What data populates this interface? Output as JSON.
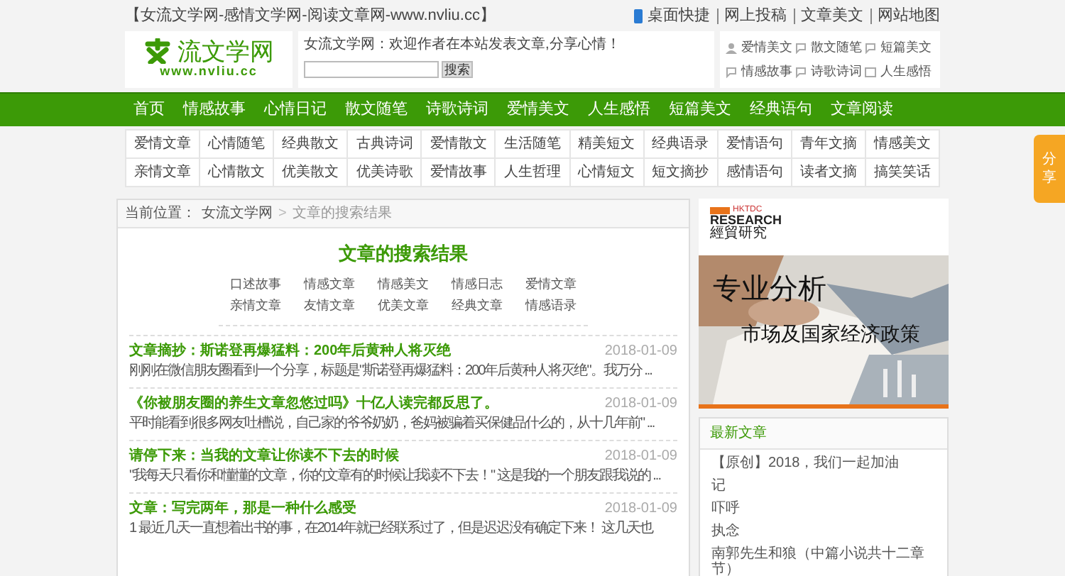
{
  "top_bar": {
    "site_line": "【女流文学网-感情文学网-阅读文章网-www.nvliu.cc】",
    "links": [
      "桌面快捷",
      "网上投稿",
      "文章美文",
      "网站地图"
    ]
  },
  "header": {
    "logo_name": "流文学网",
    "logo_url": "www.nvliu.cc",
    "welcome": "女流文学网：欢迎作者在本站发表文章,分享心情！",
    "search_button": "搜索",
    "quick_links": [
      {
        "label": "爱情美文",
        "kind": "person"
      },
      {
        "label": "散文随笔",
        "kind": "chat"
      },
      {
        "label": "短篇美文",
        "kind": "chat"
      },
      {
        "label": "情感故事",
        "kind": "chat"
      },
      {
        "label": "诗歌诗词",
        "kind": "chat"
      },
      {
        "label": "人生感悟",
        "kind": "doc"
      }
    ]
  },
  "main_nav": [
    "首页",
    "情感故事",
    "心情日记",
    "散文随笔",
    "诗歌诗词",
    "爱情美文",
    "人生感悟",
    "短篇美文",
    "经典语句",
    "文章阅读"
  ],
  "sub_nav": [
    "爱情文章",
    "心情随笔",
    "经典散文",
    "古典诗词",
    "爱情散文",
    "生活随笔",
    "精美短文",
    "经典语录",
    "爱情语句",
    "青年文摘",
    "情感美文",
    "亲情文章",
    "心情散文",
    "优美散文",
    "优美诗歌",
    "爱情故事",
    "人生哲理",
    "心情短文",
    "短文摘抄",
    "感情语句",
    "读者文摘",
    "搞笑笑话"
  ],
  "share_tab": "分享",
  "breadcrumb": {
    "label": "当前位置：",
    "home": "女流文学网",
    "separator": ">",
    "current": "文章的搜索结果"
  },
  "results": {
    "title": "**文章**的搜索结果",
    "categories": [
      "口述故事",
      "情感文章",
      "情感美文",
      "情感日志",
      "爱情文章",
      "亲情文章",
      "友情文章",
      "优美文章",
      "经典文章",
      "情感语录"
    ],
    "articles": [
      {
        "title": "文章摘抄：斯诺登再爆猛料：200年后黄种人将灭绝",
        "date": "2018-01-09",
        "excerpt": "刚刚在微信朋友圈看到一个分享，标题是\"斯诺登再爆猛料：200年后黄种人将灭绝\"。我万分 ..."
      },
      {
        "title": "《你被朋友圈的养生文章忽悠过吗》十亿人读完都反思了。",
        "date": "2018-01-09",
        "excerpt": "平时能看到很多网友吐槽说，自己家的爷爷奶奶，爸妈被骗着买保健品什么的，从十几年前\" ..."
      },
      {
        "title": "请停下来：当我的文章让你读不下去的时候",
        "date": "2018-01-09",
        "excerpt": "\"我每天只看你和懂懂的文章，你的文章有的时候让我读不下去！\" 这是我的一个朋友跟我说的 ..."
      },
      {
        "title": "文章：写完两年，那是一种什么感受",
        "date": "2018-01-09",
        "excerpt": "1 最近几天一直想着出书的事，在2014年就已经联系过了，但是迟迟没有确定下来！ 这几天也"
      }
    ]
  },
  "ad": {
    "brand": "HKTDC",
    "brand_title": "RESEARCH",
    "brand_sub": "經貿研究",
    "headline": "专业分析",
    "subline": "市场及国家经济政策"
  },
  "latest": {
    "title": "最新文章",
    "items": [
      "【原创】2018，我们一起加油",
      "记",
      "吓呼",
      "执念",
      "南郭先生和狼（中篇小说共十二章节）"
    ]
  }
}
